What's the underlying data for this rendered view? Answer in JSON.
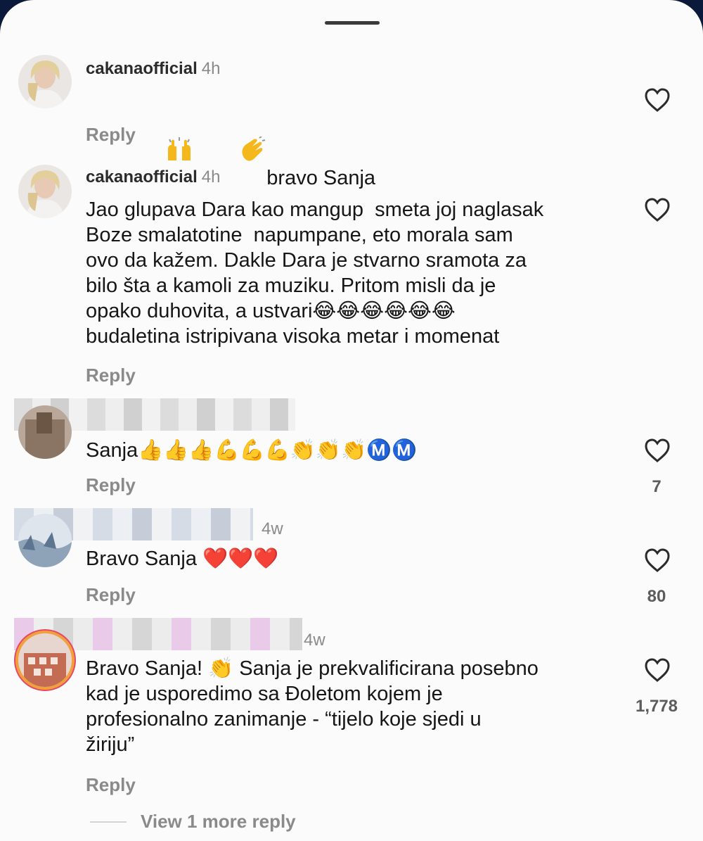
{
  "comments": [
    {
      "username": "cakanaofficial",
      "time": "4h",
      "text": "bravo Sanja",
      "reply_label": "Reply"
    },
    {
      "username": "cakanaofficial",
      "time": "4h",
      "text": "Jao glupava Dara kao mangup  smeta joj naglasak\nBoze smalatotine  napumpane, eto morala sam\novo da kažem. Dakle Dara je stvarno sramota za\nbilo šta a kamoli za muziku. Pritom misli da je\nopako duhovita, a ustvari😂😂😂😂😂😂\nbudaletina istripivana visoka metar i momenat",
      "reply_label": "Reply"
    },
    {
      "text": "Sanja👍👍👍💪💪💪👏👏👏Ⓜ️Ⓜ️",
      "reply_label": "Reply",
      "likes": "7"
    },
    {
      "time": "4w",
      "text": "Bravo Sanja ❤️❤️❤️",
      "reply_label": "Reply",
      "likes": "80"
    },
    {
      "time": "4w",
      "text": "Bravo Sanja! 👏 Sanja je prekvalificirana posebno\nkad je usporedimo sa Đoletom kojem je\nprofesionalno zanimanje - “tijelo koje sjedi u\nžiriju”",
      "reply_label": "Reply",
      "likes": "1,778"
    }
  ],
  "view_more_label": "View 1 more reply",
  "icons": {
    "heart": "heart-outline-icon",
    "raised_hands": "raised-hands-emoji",
    "clap": "clapping-hands-emoji"
  },
  "colors": {
    "background": "#fbfbfb",
    "muted_text": "#8a8a8a",
    "body_text": "#161616",
    "story_ring": "#f2a03a"
  }
}
